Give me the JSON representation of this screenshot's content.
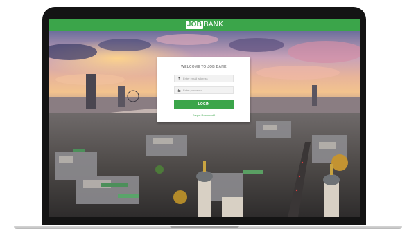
{
  "header": {
    "logo_highlight": "JOB",
    "logo_rest": "BANK"
  },
  "login": {
    "title": "WELCOME TO JOB BANK",
    "email_placeholder": "Enter email address",
    "password_placeholder": "Enter password",
    "button_label": "LOGIN",
    "forgot_link": "Forgot Password?"
  },
  "colors": {
    "brand_green": "#3ba54a",
    "frame": "#141414",
    "card": "#ffffff"
  },
  "icons": {
    "email_field": "user-icon",
    "password_field": "lock-icon"
  }
}
